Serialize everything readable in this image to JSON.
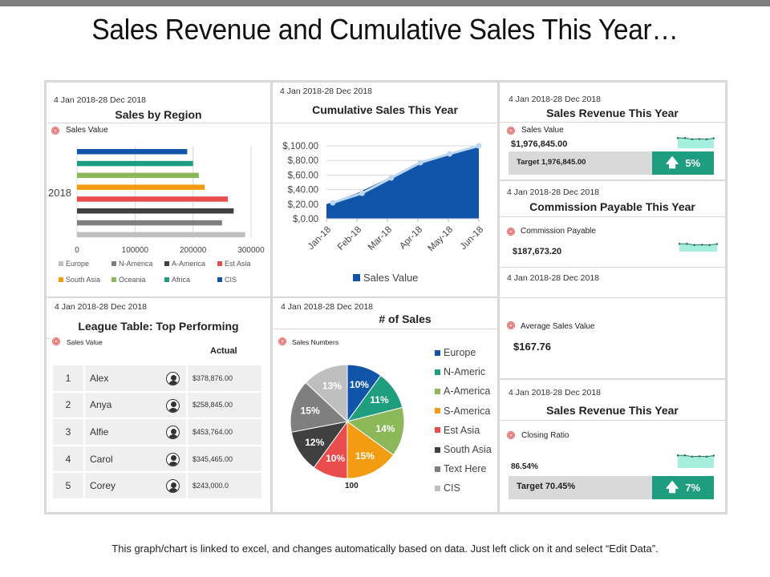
{
  "page": {
    "title": "Sales Revenue and Cumulative Sales This Year…",
    "footer_note": "This graph/chart is linked to excel, and changes automatically based on data. Just left click on it and select “Edit Data”."
  },
  "date_range": "4 Jan 2018-28 Dec 2018",
  "panels": {
    "region": {
      "title": "Sales by Region",
      "legend_label": "Sales Value"
    },
    "cumulative": {
      "title": "Cumulative Sales This Year"
    },
    "revenue": {
      "title": "Sales Revenue This Year",
      "label": "Sales Value",
      "value": "$1,976,845.00",
      "target": "Target  1,976,845.00",
      "change": "5%",
      "spark": [
        0.8,
        0.8,
        0.55,
        0.6,
        0.55,
        0.75
      ]
    },
    "commission": {
      "title": "Commission Payable This Year",
      "label": "Commission  Payable",
      "value": "$187,673.20",
      "spark": [
        0.8,
        0.8,
        0.55,
        0.6,
        0.55,
        0.75
      ]
    },
    "average": {
      "label": "Average Sales Value",
      "value": "$167.76"
    },
    "closing": {
      "title": "Sales Revenue This Year",
      "label": "Closing Ratio",
      "value": "86.54%",
      "target": "Target  70.45%",
      "change": "7%",
      "spark": [
        0.8,
        0.8,
        0.55,
        0.6,
        0.55,
        0.75
      ]
    },
    "league": {
      "title": "League Table: Top Performing",
      "label": "Sales Value",
      "column_header": "Actual",
      "rows": [
        {
          "rank": "1",
          "name": "Alex",
          "value": "$378,876.00"
        },
        {
          "rank": "2",
          "name": "Anya",
          "value": "$258,845.00"
        },
        {
          "rank": "3",
          "name": "Alfie",
          "value": "$453,764.00"
        },
        {
          "rank": "4",
          "name": "Carol",
          "value": "$345,465.00"
        },
        {
          "rank": "5",
          "name": "Corey",
          "value": "$243,000.0"
        }
      ]
    },
    "sales_count": {
      "title": "# of Sales",
      "label": "Sales Numbers",
      "total": "100"
    }
  },
  "colors": {
    "teal": "#1f9d7f",
    "spark_fill": "#a6eedd",
    "area_blue": "#1155aa",
    "line_light": "#bcd7ef"
  },
  "chart_data": [
    {
      "type": "bar",
      "orientation": "horizontal",
      "title": "Sales by Region",
      "category_label": "2018",
      "xlim": [
        0,
        300000
      ],
      "xticks": [
        "0",
        "100000",
        "200000",
        "300000"
      ],
      "grid": true,
      "legend_position": "bottom",
      "series": [
        {
          "name": "Europe",
          "value": 290000,
          "color": "#bfbfbf"
        },
        {
          "name": "N-America",
          "value": 250000,
          "color": "#7f7f7f"
        },
        {
          "name": "A-America",
          "value": 270000,
          "color": "#404040"
        },
        {
          "name": "Est Asia",
          "value": 260000,
          "color": "#e84c4c"
        },
        {
          "name": "South Asia",
          "value": 220000,
          "color": "#f39c12"
        },
        {
          "name": "Oceania",
          "value": 210000,
          "color": "#8db85a"
        },
        {
          "name": "Africa",
          "value": 200000,
          "color": "#1f9d7f"
        },
        {
          "name": "CIS",
          "value": 190000,
          "color": "#1155aa"
        }
      ]
    },
    {
      "type": "area",
      "title": "Cumulative Sales This Year",
      "categories": [
        "Jan-18",
        "Feb-18",
        "Mar-18",
        "Apr-18",
        "May-18",
        "Jun-18"
      ],
      "yticks": [
        "$,0.00",
        "$,20.00",
        "$,40.00",
        "$,60.00",
        "$,80.00",
        "$,100.00"
      ],
      "ylim": [
        0,
        100
      ],
      "grid": true,
      "legend_position": "bottom",
      "series": [
        {
          "name": "Sales Value",
          "values": [
            20,
            35,
            55,
            77,
            88,
            100
          ]
        }
      ],
      "line_markers": [
        22,
        35,
        56,
        77,
        89,
        100
      ]
    },
    {
      "type": "pie",
      "title": "# of Sales",
      "legend_position": "right",
      "slices": [
        {
          "label": "Europe",
          "value": 10,
          "color": "#1155aa"
        },
        {
          "label": "N-Americ",
          "value": 11,
          "color": "#1f9d7f"
        },
        {
          "label": "A-America",
          "value": 14,
          "color": "#8db85a"
        },
        {
          "label": "S-America",
          "value": 15,
          "color": "#f39c12"
        },
        {
          "label": "Est Asia",
          "value": 10,
          "color": "#e84c4c"
        },
        {
          "label": "South Asia",
          "value": 12,
          "color": "#404040"
        },
        {
          "label": "Text Here",
          "value": 15,
          "color": "#7f7f7f"
        },
        {
          "label": "CIS",
          "value": 13,
          "color": "#bfbfbf"
        }
      ]
    }
  ]
}
